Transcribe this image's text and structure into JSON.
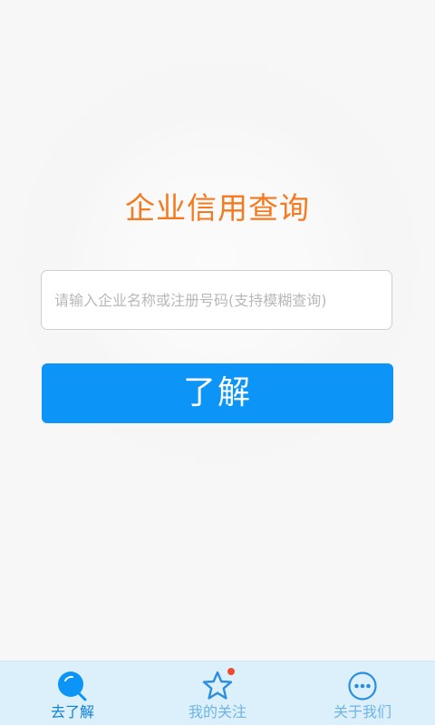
{
  "main": {
    "title": "企业信用查询",
    "search": {
      "placeholder": "请输入企业名称或注册号码(支持模糊查询)",
      "value": ""
    },
    "submit_label": "了解"
  },
  "tabbar": {
    "tabs": [
      {
        "label": "去了解",
        "icon": "search-icon",
        "active": true
      },
      {
        "label": "我的关注",
        "icon": "star-icon",
        "active": false,
        "badge": true
      },
      {
        "label": "关于我们",
        "icon": "more-icon",
        "active": false
      }
    ]
  },
  "colors": {
    "title": "#f5791f",
    "primary": "#0c95f7",
    "tabbar_bg": "#dcf0fc",
    "tab_active": "#0c7fd6",
    "tab_inactive": "#6fb3e6",
    "badge": "#f04a2a"
  }
}
